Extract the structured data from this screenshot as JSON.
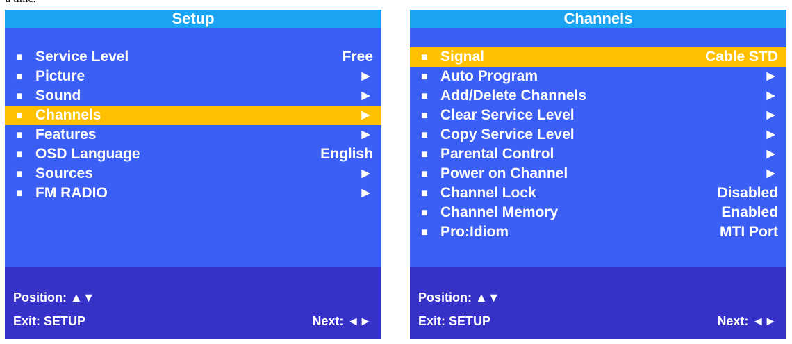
{
  "caption": "a time.",
  "bullet": "■",
  "setup": {
    "title": "Setup",
    "items": [
      {
        "label": "Service Level",
        "value": "Free"
      },
      {
        "label": "Picture",
        "value": "►"
      },
      {
        "label": "Sound",
        "value": "►"
      },
      {
        "label": "Channels",
        "value": "►"
      },
      {
        "label": "Features",
        "value": "►"
      },
      {
        "label": "OSD Language",
        "value": "English"
      },
      {
        "label": "Sources",
        "value": "►"
      },
      {
        "label": "FM RADIO",
        "value": "►"
      }
    ],
    "selected_item": "Channels",
    "footer": {
      "position": "Position: ▲▼",
      "exit": "Exit: SETUP",
      "next": "Next: ◄►"
    }
  },
  "channels": {
    "title": "Channels",
    "items": [
      {
        "label": "Signal",
        "value": "Cable STD"
      },
      {
        "label": "Auto Program",
        "value": "►"
      },
      {
        "label": "Add/Delete Channels",
        "value": "►"
      },
      {
        "label": "Clear Service Level",
        "value": "►"
      },
      {
        "label": "Copy Service Level",
        "value": "►"
      },
      {
        "label": "Parental Control",
        "value": "►"
      },
      {
        "label": "Power on Channel",
        "value": "►"
      },
      {
        "label": "Channel Lock",
        "value": "Disabled"
      },
      {
        "label": "Channel Memory",
        "value": "Enabled"
      },
      {
        "label": "Pro:Idiom",
        "value": "MTI Port"
      }
    ],
    "selected_item": "Signal",
    "footer": {
      "position": "Position: ▲▼",
      "exit": "Exit: SETUP",
      "next": "Next: ◄►"
    }
  },
  "colors": {
    "panel_bg": "#3b5ef5",
    "title_bar": "#1aa3f0",
    "highlight": "#ffc000",
    "footer_bg": "#3632c8",
    "text": "#ffffff"
  }
}
